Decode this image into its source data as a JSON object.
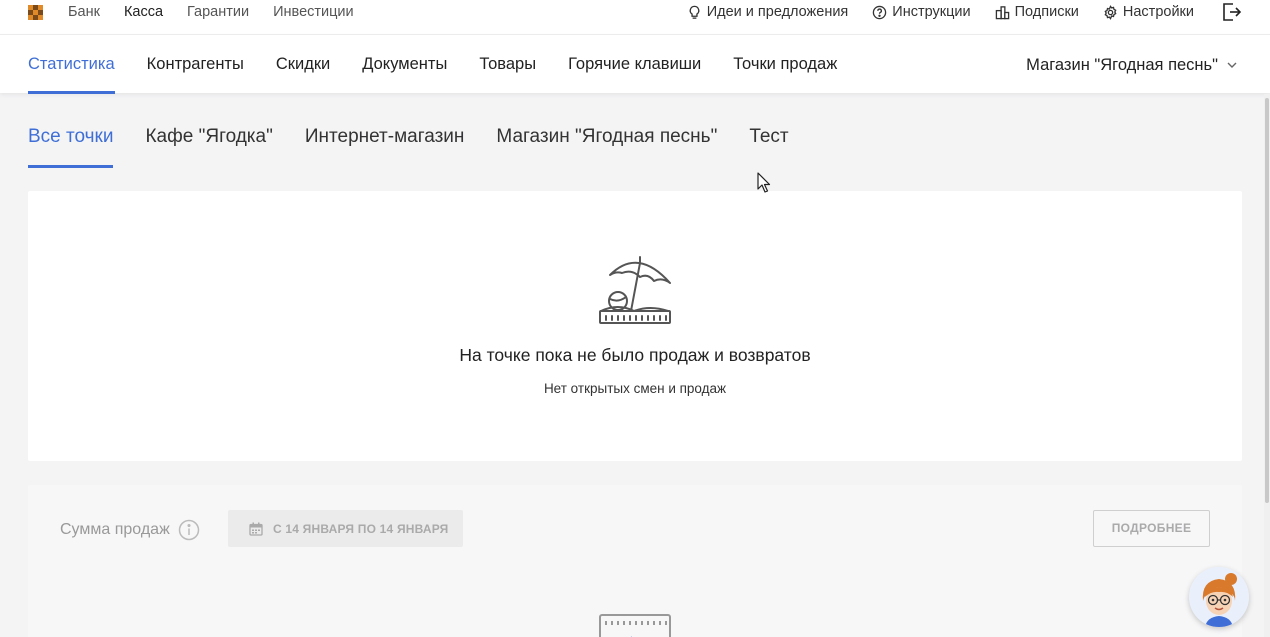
{
  "topbar": {
    "links": [
      "Банк",
      "Касса",
      "Гарантии",
      "Инвестиции"
    ],
    "active_link": "Касса",
    "right_items": {
      "ideas": "Идеи и предложения",
      "instructions": "Инструкции",
      "subscriptions": "Подписки",
      "settings": "Настройки"
    }
  },
  "mainnav": {
    "items": [
      "Статистика",
      "Контрагенты",
      "Скидки",
      "Документы",
      "Товары",
      "Горячие клавиши",
      "Точки продаж"
    ],
    "active": "Статистика",
    "store_selector": "Магазин \"Ягодная песнь\""
  },
  "subtabs": {
    "items": [
      "Все точки",
      "Кафе \"Ягодка\"",
      "Интернет-магазин",
      "Магазин \"Ягодная песнь\"",
      "Тест"
    ],
    "active": "Все точки"
  },
  "empty_state": {
    "title": "На точке пока не было продаж и возвратов",
    "subtitle": "Нет открытых смен и продаж"
  },
  "sales": {
    "label": "Сумма продаж",
    "date_range": "С 14 ЯНВАРЯ ПО 14 ЯНВАРЯ",
    "details_button": "ПОДРОБНЕЕ"
  },
  "colors": {
    "accent": "#3f6fd6",
    "background": "#f4f4f5"
  }
}
